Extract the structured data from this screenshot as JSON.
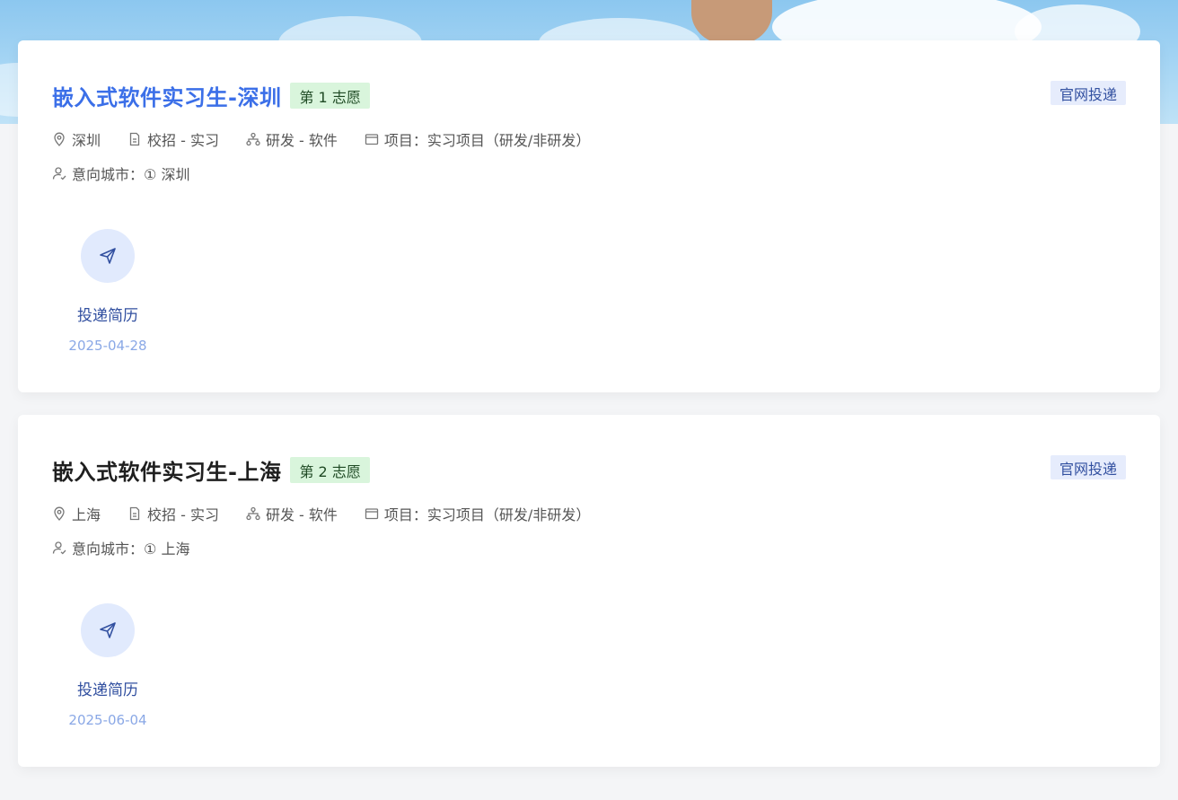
{
  "jobs": [
    {
      "title": "嵌入式软件实习生-深圳",
      "preference": "第 1 志愿",
      "channel": "官网投递",
      "location": "深圳",
      "recruit_type": "校招 - 实习",
      "category": "研发 - 软件",
      "project": "项目：实习项目（研发/非研发）",
      "intended_city_label": "意向城市：",
      "intended_city_value": "① 深圳",
      "action_label": "投递简历",
      "action_date": "2025-04-28"
    },
    {
      "title": "嵌入式软件实习生-上海",
      "preference": "第 2 志愿",
      "channel": "官网投递",
      "location": "上海",
      "recruit_type": "校招 - 实习",
      "category": "研发 - 软件",
      "project": "项目：实习项目（研发/非研发）",
      "intended_city_label": "意向城市：",
      "intended_city_value": "① 上海",
      "action_label": "投递简历",
      "action_date": "2025-06-04"
    }
  ],
  "icons": {
    "location": "location-pin-icon",
    "recruit": "document-icon",
    "category": "org-structure-icon",
    "project": "folder-icon",
    "city": "user-check-icon",
    "action": "send-icon"
  },
  "colors": {
    "active_title": "#3b6fe8",
    "title": "#1f1f1f",
    "pref_tag_bg": "#d9f5dc",
    "channel_tag_bg": "#e6ecfc",
    "action_circle_bg": "#e1eafd",
    "date": "#8aa8e6"
  }
}
